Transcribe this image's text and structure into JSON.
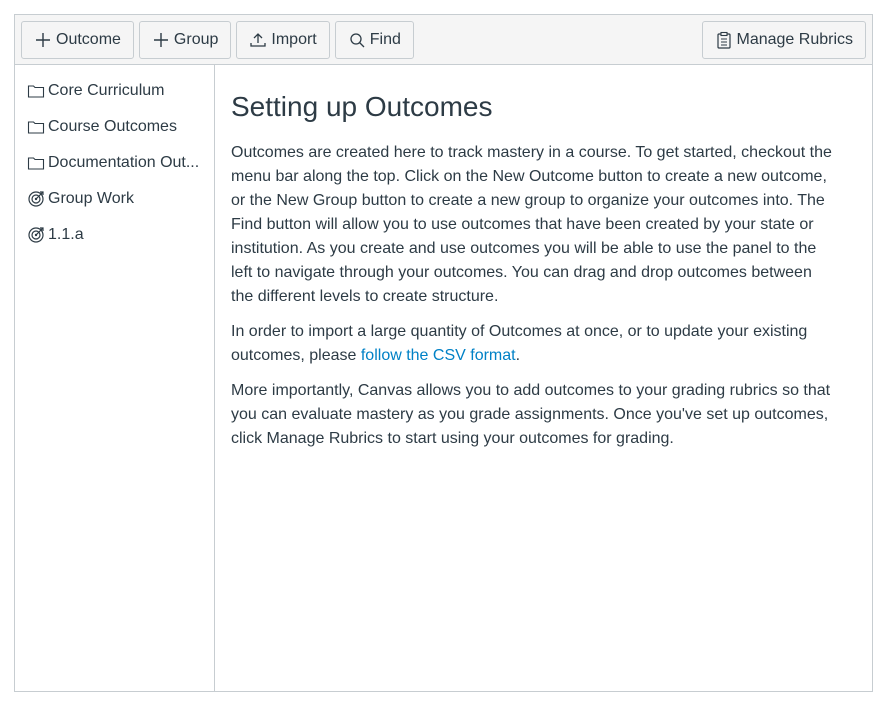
{
  "toolbar": {
    "outcome_label": "Outcome",
    "group_label": "Group",
    "import_label": "Import",
    "find_label": "Find",
    "manage_rubrics_label": "Manage Rubrics"
  },
  "sidebar": {
    "items": [
      {
        "label": "Core Curriculum",
        "icon": "folder-icon"
      },
      {
        "label": "Course Outcomes",
        "icon": "folder-icon"
      },
      {
        "label": "Documentation Out...",
        "icon": "folder-icon"
      },
      {
        "label": "Group Work",
        "icon": "outcomes-target-icon"
      },
      {
        "label": "1.1.a",
        "icon": "outcomes-target-icon"
      }
    ]
  },
  "main": {
    "title": "Setting up Outcomes",
    "paragraph1": "Outcomes are created here to track mastery in a course. To get started, checkout the menu bar along the top. Click on the New Outcome button to create a new outcome, or the New Group button to create a new group to organize your outcomes into. The Find button will allow you to use outcomes that have been created by your state or institution. As you create and use outcomes you will be able to use the panel to the left to navigate through your outcomes. You can drag and drop outcomes between the different levels to create structure.",
    "paragraph2_prefix": "In order to import a large quantity of Outcomes at once, or to update your existing outcomes, please ",
    "paragraph2_link": "follow the CSV format",
    "paragraph2_suffix": ".",
    "paragraph3": "More importantly, Canvas allows you to add outcomes to your grading rubrics so that you can evaluate mastery as you grade assignments. Once you've set up outcomes, click Manage Rubrics to start using your outcomes for grading."
  },
  "colors": {
    "text": "#2d3b45",
    "link": "#0081c6",
    "border": "#c7cdd1",
    "toolbar_bg": "#f5f5f5"
  }
}
